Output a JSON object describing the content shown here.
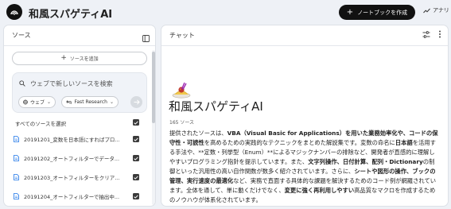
{
  "header": {
    "app_title": "和風スパゲティAI",
    "new_notebook_label": "ノートブックを作成",
    "analytics_label": "アナリ",
    "logo_icon": "notebooklm-logo-icon"
  },
  "sources_panel": {
    "title": "ソース",
    "add_source_label": "ソースを追加",
    "search_placeholder": "ウェブで新しいソースを検索",
    "chip_web": "ウェブ",
    "chip_research": "Fast Research",
    "select_all_label": "すべてのソースを選択",
    "items": [
      {
        "label": "20191201_変数を日本語にすればプロ..."
      },
      {
        "label": "20191202_オートフィルターでデータ..."
      },
      {
        "label": "20191203_オートフィルターをクリア..."
      },
      {
        "label": "20191204_オートフィルターで抽出中..."
      }
    ]
  },
  "chat_panel": {
    "title": "チャット",
    "notebook_title": "和風スパゲティAI",
    "source_count": "165 ソース",
    "summary_parts": [
      {
        "t": "提供されたソースは、",
        "b": false
      },
      {
        "t": "VBA（Visual Basic for Applications）を用いた業務効率化や、コードの保守性・可読性",
        "b": true
      },
      {
        "t": "を高めるための実践的なテクニックをまとめた解説集です。変数の命名に",
        "b": false
      },
      {
        "t": "日本語",
        "b": true
      },
      {
        "t": "を活用する手法や、**定数・列挙型（Enum）**によるマジックナンバーの排除など、開発者が直感的に理解しやすいプログラミング指針を提示しています。また、",
        "b": false
      },
      {
        "t": "文字列操作、日付計算、配列・Dictionary",
        "b": true
      },
      {
        "t": "の制御といった汎用性の高い自作関数が数多く紹介されています。さらに、",
        "b": false
      },
      {
        "t": "シートや図形の操作、ブックの管理、実行速度の最適化",
        "b": true
      },
      {
        "t": "など、実務で直面する具体的な課題を解決するためのコード例が網羅されています。全体を通して、単に動くだけでなく、",
        "b": false
      },
      {
        "t": "変更に強く再利用しやすい",
        "b": true
      },
      {
        "t": "高品質なマクロを作成するためのノウハウが体系化されています。",
        "b": false
      }
    ]
  },
  "colors": {
    "background": "#eef1f6",
    "panel": "#ffffff",
    "primary_button": "#111111",
    "checkbox": "#3b3b3b"
  }
}
